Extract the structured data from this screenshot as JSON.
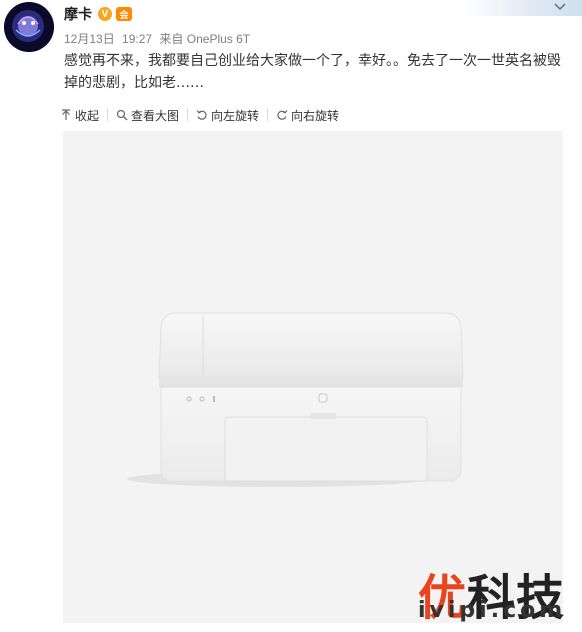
{
  "post": {
    "username": "摩卡",
    "vip_badge": "V",
    "member_badge": "会",
    "date": "12月13日",
    "time": "19:27",
    "source": "来自 OnePlus 6T",
    "text": "感觉再不来，我都要自己创业给大家做一个了，幸好。。免去了一次一世英名被毁掉的悲剧，比如老……"
  },
  "toolbar": {
    "collapse_label": "收起",
    "view_large_label": "查看大图",
    "rotate_left_label": "向左旋转",
    "rotate_right_label": "向右旋转"
  },
  "image": {
    "watermark_part1": "优",
    "watermark_part2": "科技",
    "watermark_domain": "ivipi.com"
  },
  "icons": {
    "collapse": "arrow-up-icon",
    "view_large": "magnifier-icon",
    "rotate_left": "rotate-left-icon",
    "rotate_right": "rotate-right-icon",
    "more": "chevron-down-icon"
  },
  "colors": {
    "watermark_orange": "#e8451f",
    "vip_orange": "#f5a623",
    "meta_gray": "#808080"
  }
}
